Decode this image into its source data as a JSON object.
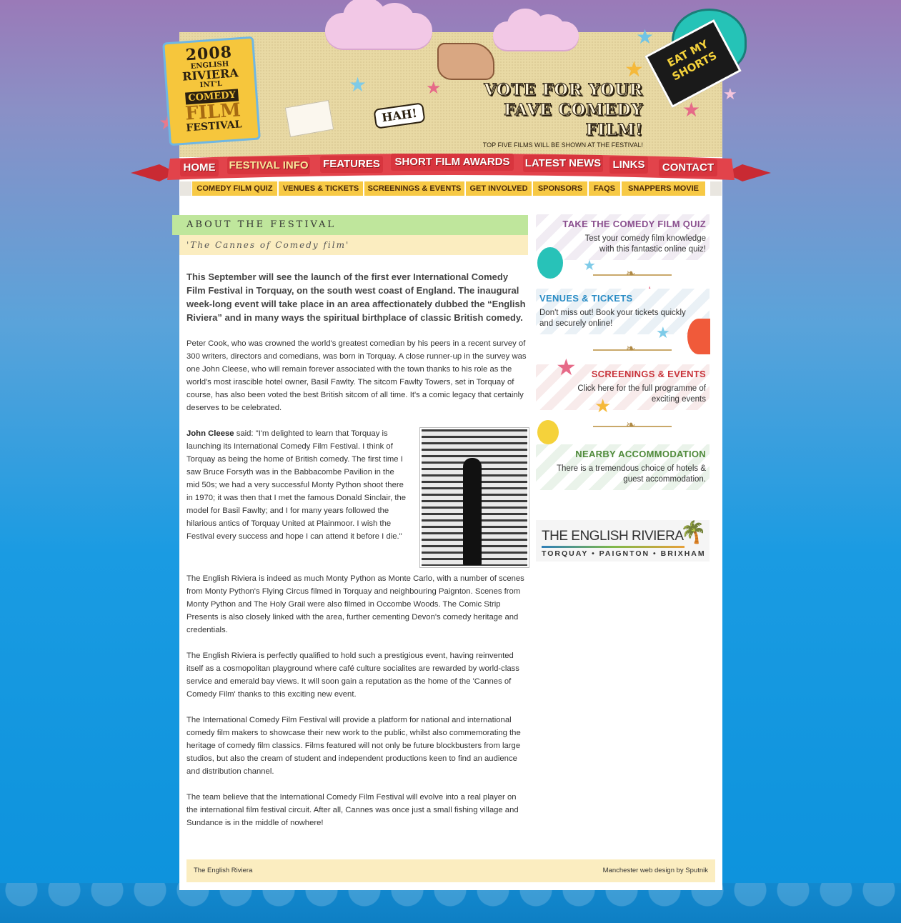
{
  "banner": {
    "logo": {
      "year": "2008",
      "line1": "ENGLISH",
      "line2": "RIVIERA",
      "line3": "INT'L",
      "line4": "COMEDY",
      "line5": "FILM",
      "line6": "FESTIVAL"
    },
    "vote_title": "VOTE FOR YOUR FAVE COMEDY FILM!",
    "vote_sub": "TOP FIVE FILMS WILL BE SHOWN AT THE FESTIVAL!",
    "hah": "HAH!",
    "shorts": "EAT MY SHORTS"
  },
  "nav": {
    "main": [
      {
        "label": "HOME",
        "active": false
      },
      {
        "label": "FESTIVAL INFO",
        "active": true
      },
      {
        "label": "FEATURES",
        "active": false
      },
      {
        "label": "SHORT FILM AWARDS",
        "active": false
      },
      {
        "label": "LATEST NEWS",
        "active": false
      },
      {
        "label": "LINKS",
        "active": false
      },
      {
        "label": "CONTACT",
        "active": false
      }
    ],
    "sub": [
      "COMEDY FILM QUIZ",
      "VENUES & TICKETS",
      "SCREENINGS & EVENTS",
      "GET INVOLVED",
      "SPONSORS",
      "FAQS",
      "SNAPPERS MOVIE"
    ]
  },
  "content": {
    "heading": "ABOUT THE FESTIVAL",
    "subheading": "'The Cannes of Comedy film'",
    "lead": "This September will see the launch of the first ever International Comedy Film Festival in Torquay, on the south west coast of England. The inaugural week-long event will take place in an area affectionately dubbed the “English Riviera” and in many ways the spiritual birthplace of classic British comedy.",
    "p1": "Peter Cook, who was crowned the world's greatest comedian by his peers in a recent survey of 300 writers, directors and comedians, was born in Torquay. A close runner-up in the survey was one John Cleese, who will remain forever associated with the town thanks to his role as the world's most irascible hotel owner, Basil Fawlty. The sitcom Fawlty Towers, set in Torquay of course, has also been voted the best British sitcom of all time. It's a comic legacy that certainly deserves to be celebrated.",
    "p2_name": "John Cleese",
    "p2_said": " said: \"I'm delighted to learn that Torquay is launching its International Comedy Film Festival. I think of Torquay as being the home of British comedy. The first time I saw Bruce Forsyth was in the Babbacombe Pavilion in the mid 50s; we had a very successful Monty Python shoot there in 1970; it was then that I met the famous Donald Sinclair, the model for Basil Fawlty; and I for many years followed the hilarious antics of Torquay United at Plainmoor. I wish the Festival every success and hope I can attend it before I die.\"",
    "p3": "The English Riviera is indeed as much Monty Python as Monte Carlo, with a number of scenes from Monty Python's Flying Circus filmed in Torquay and neighbouring Paignton. Scenes from Monty Python and The Holy Grail were also filmed in Occombe Woods. The Comic Strip Presents is also closely linked with the area, further cementing Devon's comedy heritage and credentials.",
    "p4": "The English Riviera is perfectly qualified to hold such a prestigious event, having reinvented itself as a cosmopolitan playground where café culture socialites are rewarded by world-class service and emerald bay views. It will soon gain a reputation as the home of the 'Cannes of Comedy Film' thanks to this exciting new event.",
    "p5": "The International Comedy Film Festival will provide a platform for national and international comedy film makers to showcase their new work to the public, whilst also commemorating the heritage of comedy film classics. Films featured will not only be future blockbusters from large studios, but also the cream of student and independent productions keen to find an audience and distribution channel.",
    "p6": "The team believe that the International Comedy Film Festival will evolve into a real player on the international film festival circuit. After all, Cannes was once just a small fishing village and Sundance is in the middle of nowhere!"
  },
  "sidebar": {
    "quiz": {
      "title": "TAKE THE COMEDY FILM QUIZ",
      "text": "Test your comedy film knowledge with this fantastic online quiz!",
      "color": "#8a4f8e"
    },
    "venues": {
      "title": "VENUES & TICKETS",
      "text": "Don't miss out! Book your tickets quickly and securely online!",
      "color": "#2a8cc5"
    },
    "screenings": {
      "title": "SCREENINGS & EVENTS",
      "text": "Click here for the full programme of exciting events",
      "color": "#c8333a"
    },
    "accommodation": {
      "title": "NEARBY ACCOMMODATION",
      "text": "There is a tremendous choice of hotels & guest accommodation.",
      "color": "#4f8a3a"
    },
    "riviera": {
      "name": "THE ENGLISH RIVIERA",
      "towns": "TORQUAY • PAIGNTON • BRIXHAM"
    }
  },
  "footer": {
    "left": "The English Riviera",
    "right": "Manchester web design by Sputnik"
  }
}
